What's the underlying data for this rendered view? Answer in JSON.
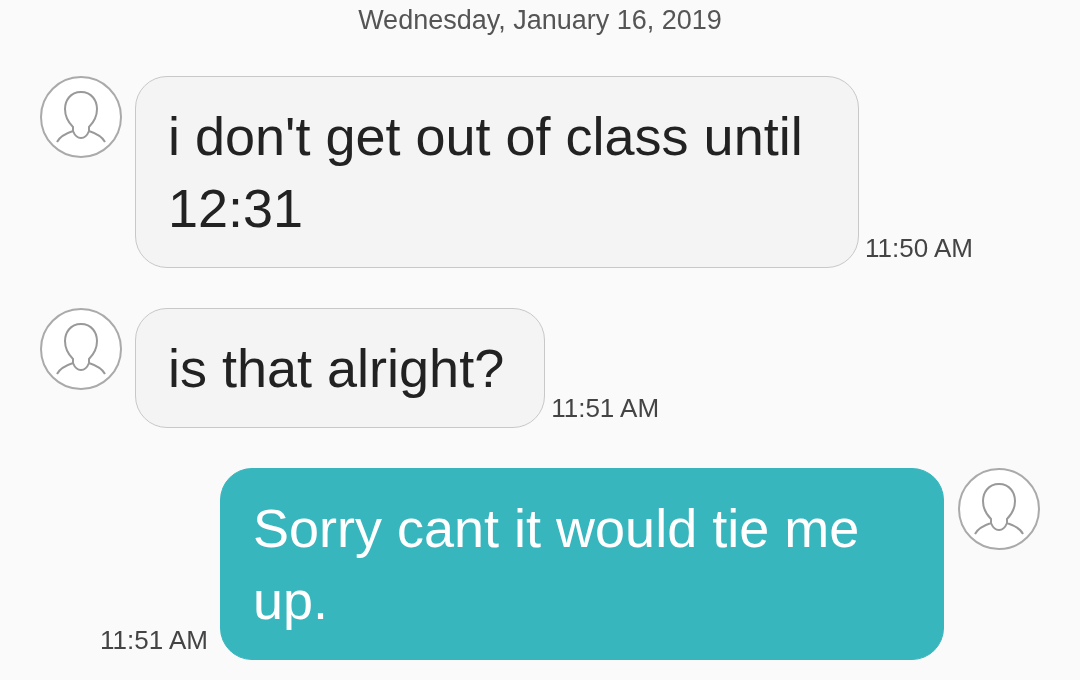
{
  "date_header": "Wednesday, January 16, 2019",
  "messages": [
    {
      "kind": "incoming",
      "text": "i don't get out of class until 12:31",
      "time": "11:50 AM"
    },
    {
      "kind": "incoming",
      "text": "is that alright?",
      "time": "11:51 AM"
    },
    {
      "kind": "outgoing",
      "text": "Sorry cant it would tie me up.",
      "time": "11:51 AM"
    }
  ]
}
